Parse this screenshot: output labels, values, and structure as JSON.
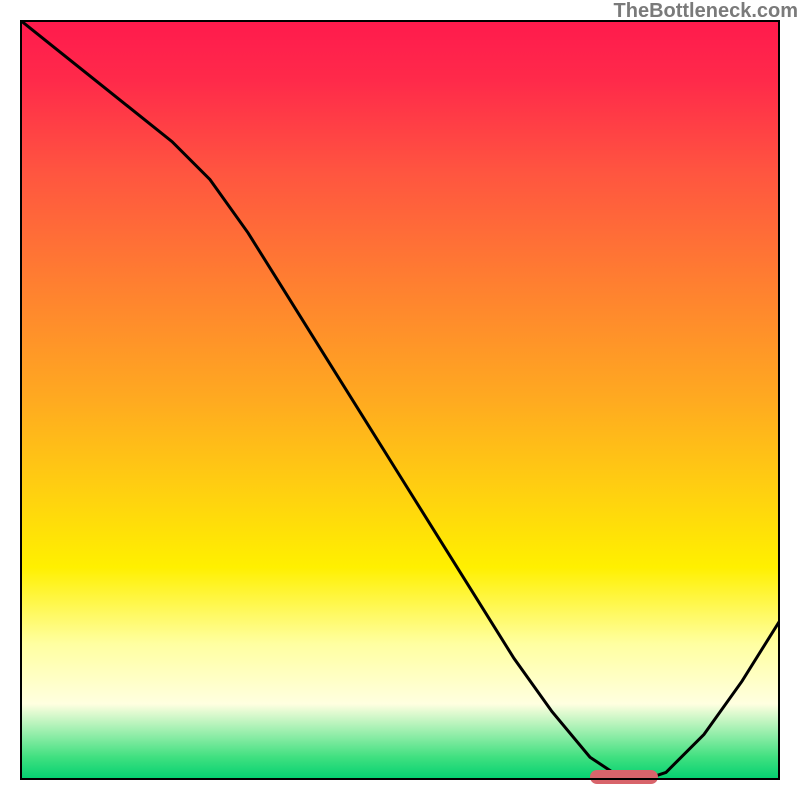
{
  "watermark": "TheBottleneck.com",
  "colors": {
    "gradient_top": "#ff1a4d",
    "gradient_mid": "#ffd010",
    "gradient_bottom": "#00d070",
    "curve": "#000000",
    "marker": "#d8646b",
    "frame": "#000000"
  },
  "chart_data": {
    "type": "line",
    "title": "",
    "xlabel": "",
    "ylabel": "",
    "xlim": [
      0,
      100
    ],
    "ylim": [
      0,
      100
    ],
    "series": [
      {
        "name": "bottleneck-curve",
        "x": [
          0,
          5,
          10,
          15,
          20,
          25,
          30,
          35,
          40,
          45,
          50,
          55,
          60,
          65,
          70,
          75,
          78,
          82,
          85,
          90,
          95,
          100
        ],
        "values": [
          100,
          96,
          92,
          88,
          84,
          79,
          72,
          64,
          56,
          48,
          40,
          32,
          24,
          16,
          9,
          3,
          1,
          0,
          1,
          6,
          13,
          21
        ]
      }
    ],
    "marker": {
      "x_start": 75,
      "x_end": 84,
      "y": 0
    },
    "grid": false,
    "legend": false
  }
}
